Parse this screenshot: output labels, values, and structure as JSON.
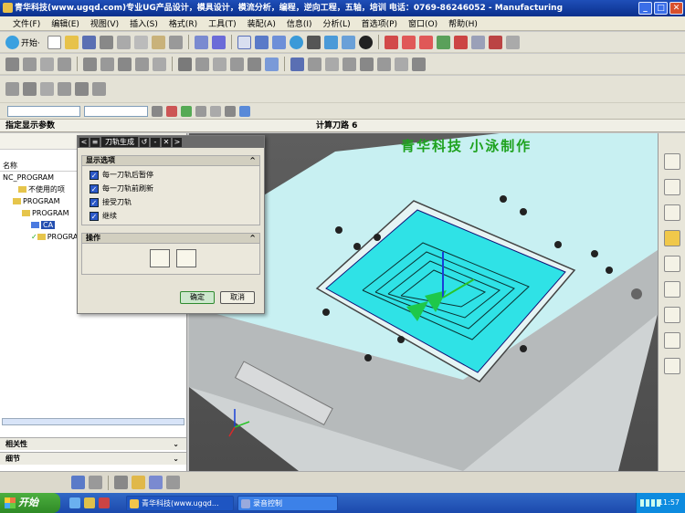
{
  "window": {
    "title": "青华科技(www.ugqd.com)专业UG产品设计，模具设计，模流分析，编程，逆向工程，五轴，培训 电话：0769-86246052 - Manufacturing",
    "min_label": "_",
    "max_label": "□",
    "close_label": "✕"
  },
  "menu": {
    "items": [
      "文件(F)",
      "编辑(E)",
      "视图(V)",
      "插入(S)",
      "格式(R)",
      "工具(T)",
      "装配(A)",
      "信息(I)",
      "分析(L)",
      "首选项(P)",
      "窗口(O)",
      "帮助(H)"
    ]
  },
  "toolbar": {
    "start_label": "开始·"
  },
  "statusbar": {
    "left": "指定显示参数",
    "center": "计算刀路 6"
  },
  "nav": {
    "column_header": "名称",
    "tree": [
      {
        "label": "NC_PROGRAM"
      },
      {
        "label": "不使用的项"
      },
      {
        "label": "PROGRAM"
      },
      {
        "label": "PROGRAM"
      },
      {
        "label": "CA"
      },
      {
        "label": "PROGRAM"
      }
    ],
    "section1": "相关性",
    "section2": "细节"
  },
  "dialog": {
    "title": "刀轨生成",
    "section_display": "显示选项",
    "options": [
      "每一刀轨后暂停",
      "每一刀轨前刷新",
      "接受刀轨",
      "继续"
    ],
    "section_ops": "操作",
    "ok_label": "确定",
    "cancel_label": "取消"
  },
  "viewport": {
    "watermark": "青华科技 小泳制作"
  },
  "taskbar": {
    "start_label": "开始",
    "tasks": [
      "青华科技(www.ugqd...",
      "录音控制"
    ],
    "clock": "11:57"
  },
  "colors": {
    "platform": "#c8f0f2",
    "pocket": "#2fe2e6",
    "watermark": "#1ea21e",
    "titlebar": "#0a2f8c",
    "taskbar": "#1c49ad"
  }
}
